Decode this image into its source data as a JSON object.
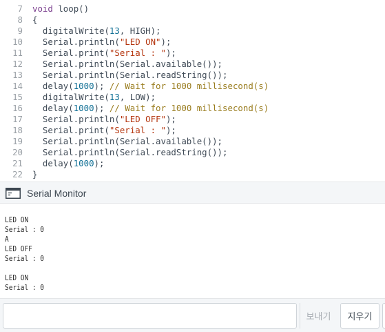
{
  "editor": {
    "lines": [
      {
        "n": "7",
        "tokens": [
          {
            "t": "void",
            "c": "kw"
          },
          {
            "t": " ",
            "c": "plain"
          },
          {
            "t": "loop",
            "c": "plain"
          },
          {
            "t": "()",
            "c": "plain"
          }
        ]
      },
      {
        "n": "8",
        "tokens": [
          {
            "t": "{",
            "c": "plain"
          }
        ]
      },
      {
        "n": "9",
        "tokens": [
          {
            "t": "  digitalWrite",
            "c": "plain"
          },
          {
            "t": "(",
            "c": "plain"
          },
          {
            "t": "13",
            "c": "num"
          },
          {
            "t": ", HIGH);",
            "c": "plain"
          }
        ]
      },
      {
        "n": "10",
        "tokens": [
          {
            "t": "  Serial.println(",
            "c": "plain"
          },
          {
            "t": "\"LED ON\"",
            "c": "str"
          },
          {
            "t": ");",
            "c": "plain"
          }
        ]
      },
      {
        "n": "11",
        "tokens": [
          {
            "t": "  Serial.print(",
            "c": "plain"
          },
          {
            "t": "\"Serial : \"",
            "c": "str"
          },
          {
            "t": ");",
            "c": "plain"
          }
        ]
      },
      {
        "n": "12",
        "tokens": [
          {
            "t": "  Serial.println(Serial.available());",
            "c": "plain"
          }
        ]
      },
      {
        "n": "13",
        "tokens": [
          {
            "t": "  Serial.println(Serial.readString());",
            "c": "plain"
          }
        ]
      },
      {
        "n": "14",
        "tokens": [
          {
            "t": "  delay(",
            "c": "plain"
          },
          {
            "t": "1000",
            "c": "num"
          },
          {
            "t": "); ",
            "c": "plain"
          },
          {
            "t": "// Wait for 1000 millisecond(s)",
            "c": "cmt"
          }
        ]
      },
      {
        "n": "15",
        "tokens": [
          {
            "t": "  digitalWrite(",
            "c": "plain"
          },
          {
            "t": "13",
            "c": "num"
          },
          {
            "t": ", LOW);",
            "c": "plain"
          }
        ]
      },
      {
        "n": "16",
        "tokens": [
          {
            "t": "  delay(",
            "c": "plain"
          },
          {
            "t": "1000",
            "c": "num"
          },
          {
            "t": "); ",
            "c": "plain"
          },
          {
            "t": "// Wait for 1000 millisecond(s)",
            "c": "cmt"
          }
        ]
      },
      {
        "n": "17",
        "tokens": [
          {
            "t": "  Serial.println(",
            "c": "plain"
          },
          {
            "t": "\"LED OFF\"",
            "c": "str"
          },
          {
            "t": ");",
            "c": "plain"
          }
        ]
      },
      {
        "n": "18",
        "tokens": [
          {
            "t": "  Serial.print(",
            "c": "plain"
          },
          {
            "t": "\"Serial : \"",
            "c": "str"
          },
          {
            "t": ");",
            "c": "plain"
          }
        ]
      },
      {
        "n": "19",
        "tokens": [
          {
            "t": "  Serial.println(Serial.available());",
            "c": "plain"
          }
        ]
      },
      {
        "n": "20",
        "tokens": [
          {
            "t": "  Serial.println(Serial.readString());",
            "c": "plain"
          }
        ]
      },
      {
        "n": "21",
        "tokens": [
          {
            "t": "  delay(",
            "c": "plain"
          },
          {
            "t": "1000",
            "c": "num"
          },
          {
            "t": ");",
            "c": "plain"
          }
        ]
      },
      {
        "n": "22",
        "tokens": [
          {
            "t": "}",
            "c": "plain"
          }
        ]
      }
    ]
  },
  "monitor": {
    "icon": "serial-monitor-window-icon",
    "title": "Serial Monitor",
    "output": [
      "LED ON",
      "Serial : 0",
      "A",
      "LED OFF",
      "Serial : 0",
      "",
      "LED ON",
      "Serial : 0"
    ]
  },
  "input_bar": {
    "input_value": "",
    "send_label": "보내기",
    "clear_label": "지우기"
  }
}
